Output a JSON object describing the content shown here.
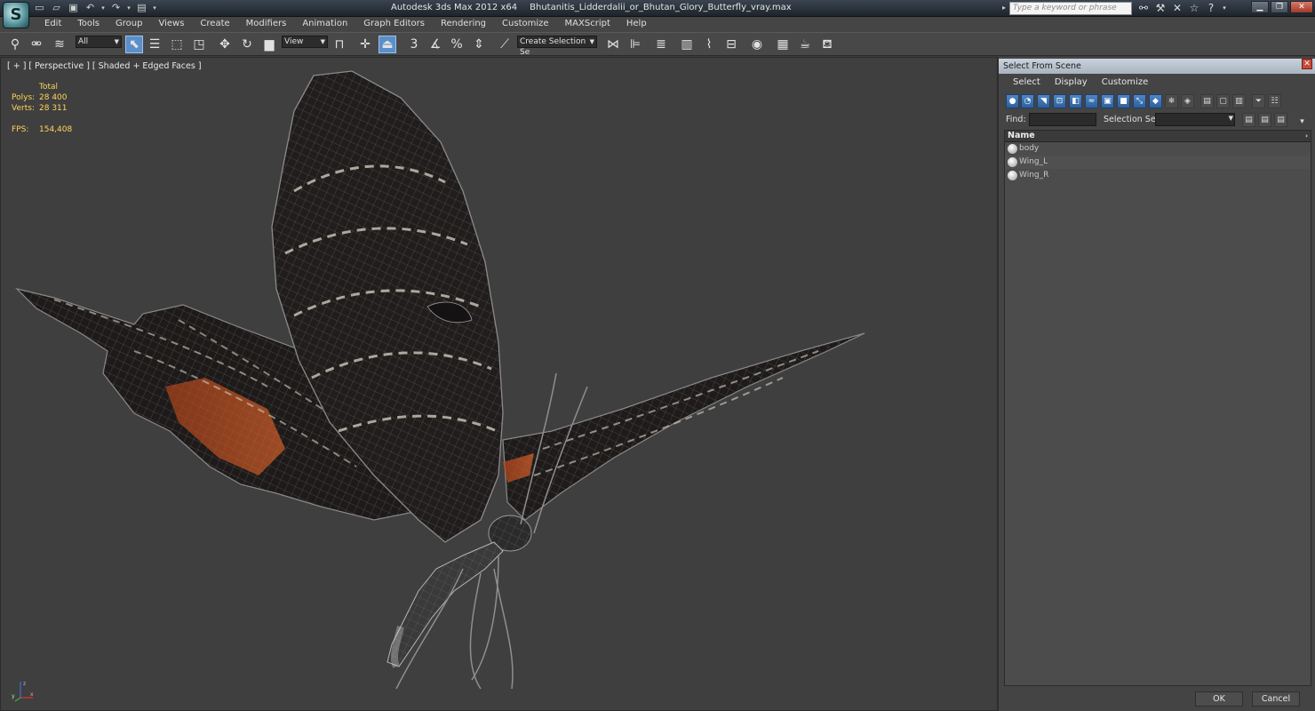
{
  "app": {
    "logo_glyph": "S",
    "window_title": "Autodesk 3ds Max  2012 x64",
    "file_name": "Bhutanitis_Lidderdalii_or_Bhutan_Glory_Butterfly_vray.max",
    "search_placeholder": "Type a keyword or phrase"
  },
  "menu": [
    "Edit",
    "Tools",
    "Group",
    "Views",
    "Create",
    "Modifiers",
    "Animation",
    "Graph Editors",
    "Rendering",
    "Customize",
    "MAXScript",
    "Help"
  ],
  "toolbar": {
    "filter_value": "All",
    "refcoord_value": "View",
    "selection_set_placeholder": "Create Selection Se"
  },
  "viewport": {
    "label": "[ + ] [ Perspective ] [ Shaded + Edged Faces ]",
    "stats": {
      "total_label": "Total",
      "polys_label": "Polys:",
      "polys_value": "28 400",
      "verts_label": "Verts:",
      "verts_value": "28 311",
      "fps_label": "FPS:",
      "fps_value": "154,408"
    },
    "gizmo": {
      "x": "x",
      "y": "y",
      "z": "z"
    }
  },
  "scene_panel": {
    "title": "Select From Scene",
    "menu": [
      "Select",
      "Display",
      "Customize"
    ],
    "find_label": "Find:",
    "selection_set_label": "Selection Set:",
    "list_header": "Name",
    "objects": [
      "body",
      "Wing_L",
      "Wing_R"
    ],
    "ok_label": "OK",
    "cancel_label": "Cancel"
  },
  "colors": {
    "stats_yellow": "#ffd45a",
    "viewport_bg": "#3f3f3f",
    "active_blue": "#5a8fc8"
  }
}
